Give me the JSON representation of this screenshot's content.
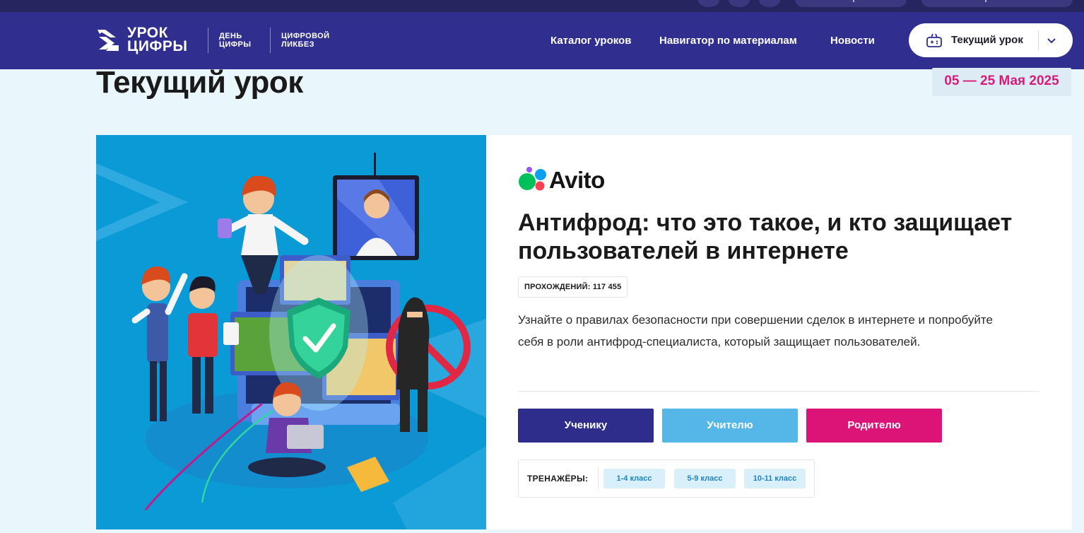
{
  "header": {
    "logo_title_line1": "УРОК",
    "logo_title_line2": "ЦИФРЫ",
    "logo_sub1_line1": "ДЕНЬ",
    "logo_sub1_line2": "ЦИФРЫ",
    "logo_sub2_line1": "ЦИФРОВОЙ",
    "logo_sub2_line2": "ЛИКБЕЗ",
    "nav": [
      "Каталог уроков",
      "Навигатор по материалам",
      "Новости"
    ],
    "current_lesson_button": "Текущий урок",
    "colors": {
      "background": "#302e8f",
      "top_strip": "#262560"
    }
  },
  "page": {
    "title": "Текущий урок",
    "date_range": "05 — 25 Мая 2025",
    "colors": {
      "background": "#e9f6fc",
      "date_text": "#d81b7a"
    }
  },
  "lesson": {
    "partner_logo_text": "Avito",
    "title": "Антифрод: что это такое, и кто защищает пользователей в интернете",
    "passes": "ПРОХОЖДЕНИЙ: 117 455",
    "description": "Узнайте о правилах безопасности при совершении сделок в интернете и попробуйте себя в роли антифрод-специалиста, который защищает пользователей.",
    "roles": [
      {
        "label": "Ученику",
        "color": "#2e2d8c"
      },
      {
        "label": "Учителю",
        "color": "#54b7e8"
      },
      {
        "label": "Родителю",
        "color": "#dd1477"
      }
    ],
    "trainers_label": "ТРЕНАЖЁРЫ:",
    "grades": [
      "1-4 класс",
      "5-9 класс",
      "10-11 класс"
    ],
    "illustration": "children-with-cybersecurity-shield-illustration"
  }
}
